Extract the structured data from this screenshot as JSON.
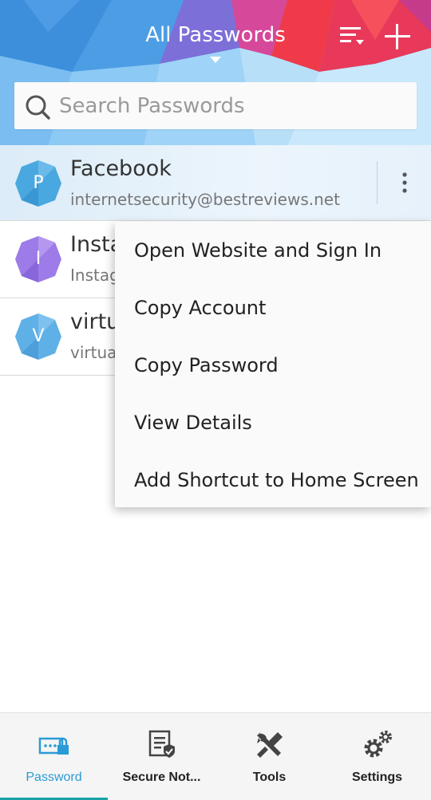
{
  "header": {
    "title": "All Passwords",
    "search_placeholder": "Search Passwords"
  },
  "colors": {
    "accent": "#2a9bd6",
    "active_indicator": "#19a3a6",
    "avatar_facebook": "#4aa8e0",
    "avatar_instagram": "#9d7be8",
    "avatar_virtual": "#5fb0e6"
  },
  "icons": {
    "sort": "sort-icon",
    "add": "plus-icon",
    "search": "search-icon",
    "more": "more-vertical-icon"
  },
  "entries": [
    {
      "letter": "P",
      "name": "Facebook",
      "sub": "internetsecurity@bestreviews.net"
    },
    {
      "letter": "I",
      "name": "Instagram",
      "sub": "Instagram"
    },
    {
      "letter": "V",
      "name": "virtual",
      "sub": "virtual"
    }
  ],
  "menu": {
    "items": [
      "Open Website and Sign In",
      "Copy Account",
      "Copy Password",
      "View Details",
      "Add Shortcut to Home Screen"
    ]
  },
  "bottom_nav": {
    "items": [
      {
        "label": "Password",
        "icon": "password-icon"
      },
      {
        "label": "Secure Not...",
        "icon": "secure-notes-icon"
      },
      {
        "label": "Tools",
        "icon": "tools-icon"
      },
      {
        "label": "Settings",
        "icon": "settings-icon"
      }
    ]
  }
}
